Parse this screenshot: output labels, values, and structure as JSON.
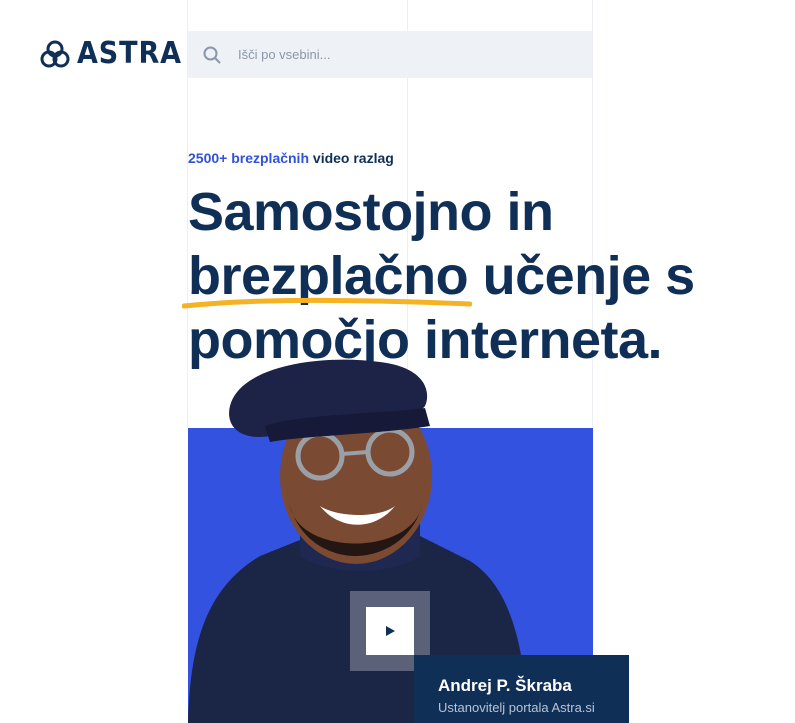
{
  "brand": {
    "name": "ASTRA"
  },
  "search": {
    "placeholder": "Išči po vsebini..."
  },
  "hero": {
    "subhead_accent": "2500+ brezplačnih",
    "subhead_rest": "video razlag",
    "headline_line1": "Samostojno in",
    "headline_highlight": "brezplačno",
    "headline_line2_rest": "učenje s",
    "headline_line3": "pomočjo interneta."
  },
  "presenter": {
    "name": "Andrej P. Škraba",
    "role": "Ustanovitelj portala Astra.si"
  },
  "colors": {
    "navy": "#0f2f57",
    "blue_accent": "#3052d8",
    "hero_blue": "#3452e0",
    "underline_yellow": "#f5b323",
    "search_bg": "#eef2f6"
  },
  "icons": {
    "search": "search-icon",
    "play": "play-icon",
    "logo": "astra-logo-icon"
  }
}
